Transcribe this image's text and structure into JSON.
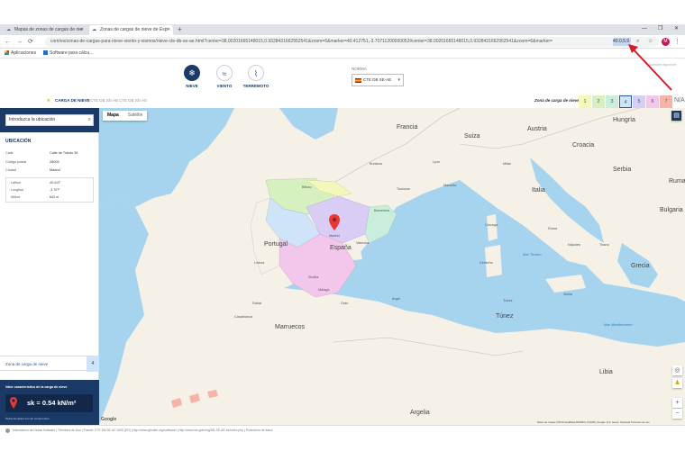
{
  "browser": {
    "tabs": [
      {
        "label": "Mapas de zonas de cargas de nie",
        "active": false
      },
      {
        "label": "Zonas de cargas de nieve de Esp",
        "active": true
      }
    ],
    "new_tab": "+",
    "window_controls": [
      "—",
      "❐",
      "✕"
    ],
    "url": "com/es/zonas-de-cargas-para-nieve-viento-y-sismos/nieve-cte-db-se-ae.html?center=38.00201665148015,0.9328431662952541&zoom=6&marker=40.412751,-3.70711200000052#center=38.00201665148015,0.9328431662952541&zoom=6&marker=",
    "url_highlight": "40.0,5.9",
    "avatar_letter": "M",
    "bookmarks": [
      "Aplicaciones",
      "Software para cálcu..."
    ]
  },
  "header": {
    "categories": [
      {
        "label": "NIEVE",
        "icon": "snowflake-icon",
        "glyph": "❄",
        "active": true
      },
      {
        "label": "VIENTO",
        "icon": "wind-icon",
        "glyph": "≈",
        "active": false
      },
      {
        "label": "TERREMOTO",
        "icon": "earthquake-icon",
        "glyph": "⌇",
        "active": false
      }
    ],
    "norma_label": "NORMA",
    "norma_value": "CTE DB SE-AE",
    "right_text": "Software disponible"
  },
  "breadcrumb": {
    "item1": "CARGA DE NIEVE",
    "item2": "CTE DB SE-AE",
    "item3": "CTE DB SE-AE"
  },
  "zones": {
    "label": "Zona de carga de nieve",
    "items": [
      {
        "n": "1",
        "color": "#f3f7b9"
      },
      {
        "n": "2",
        "color": "#d6f0c0"
      },
      {
        "n": "3",
        "color": "#c9eedc"
      },
      {
        "n": "4",
        "color": "#cfe4f8"
      },
      {
        "n": "5",
        "color": "#d9cdf5"
      },
      {
        "n": "6",
        "color": "#f3c6ec"
      },
      {
        "n": "7",
        "color": "#f6b3a8"
      }
    ],
    "selected": "4",
    "na": "N/A"
  },
  "sidebar": {
    "search_placeholder": "Introduzca la ubicación",
    "section_title": "UBICACIÓN",
    "rows": [
      {
        "k": "Calle",
        "v": "Calle de Toledo 39"
      },
      {
        "k": "Código postal",
        "v": "28005"
      },
      {
        "k": "Ciudad",
        "v": "Madrid"
      }
    ],
    "geo": [
      {
        "k": "Latitud",
        "v": "40.413°"
      },
      {
        "k": "Longitud",
        "v": "-3.707°"
      },
      {
        "k": "Altitud",
        "v": "643 m"
      }
    ],
    "zona_label": "Zona de carga de nieve",
    "zona_value": "4",
    "sk_title": "Valor característico de la carga de nieve",
    "sk_value": "sk = 0.54 kN/m²",
    "sk_note": "Todos los datos son sin compromiso."
  },
  "map": {
    "type_buttons": [
      "Mapa",
      "Satélite"
    ],
    "labels": [
      {
        "text": "Francia",
        "cls": "country"
      },
      {
        "text": "España",
        "cls": "country"
      },
      {
        "text": "Portugal",
        "cls": "country"
      },
      {
        "text": "Italia",
        "cls": "country"
      },
      {
        "text": "Hungría",
        "cls": "country"
      },
      {
        "text": "Rumania",
        "cls": "country"
      },
      {
        "text": "Grecia",
        "cls": "country"
      },
      {
        "text": "Túnez",
        "cls": "country"
      },
      {
        "text": "Argelia",
        "cls": "country"
      },
      {
        "text": "Libia",
        "cls": "country"
      },
      {
        "text": "Marruecos",
        "cls": "country"
      },
      {
        "text": "Serbia",
        "cls": "country"
      },
      {
        "text": "Bulgaria",
        "cls": "country"
      },
      {
        "text": "Croacia",
        "cls": "country"
      },
      {
        "text": "Austria",
        "cls": "country"
      },
      {
        "text": "Suiza",
        "cls": "country"
      },
      {
        "text": "Madrid",
        "cls": "city"
      },
      {
        "text": "Roma",
        "cls": "city"
      },
      {
        "text": "Nápoles",
        "cls": "city"
      },
      {
        "text": "Sicilia",
        "cls": "city"
      },
      {
        "text": "Cerdeña",
        "cls": "city"
      },
      {
        "text": "Córcega",
        "cls": "city"
      },
      {
        "text": "Túnez",
        "cls": "city"
      },
      {
        "text": "Argel",
        "cls": "city"
      },
      {
        "text": "Orán",
        "cls": "city"
      },
      {
        "text": "Barcelona",
        "cls": "city"
      },
      {
        "text": "Lisboa",
        "cls": "city"
      },
      {
        "text": "Valencia",
        "cls": "city"
      },
      {
        "text": "Sevilla",
        "cls": "city"
      },
      {
        "text": "Málaga",
        "cls": "city"
      },
      {
        "text": "Bilbao",
        "cls": "city"
      },
      {
        "text": "Marsella",
        "cls": "city"
      },
      {
        "text": "Lyon",
        "cls": "city"
      },
      {
        "text": "Milán",
        "cls": "city"
      },
      {
        "text": "Burdeos",
        "cls": "city"
      },
      {
        "text": "Toulouse",
        "cls": "city"
      },
      {
        "text": "Tirana",
        "cls": "city"
      },
      {
        "text": "Casablanca",
        "cls": "city"
      },
      {
        "text": "Rabat",
        "cls": "city"
      },
      {
        "text": "Mar Tirreno",
        "cls": "sea"
      },
      {
        "text": "Mar Mediterráneo",
        "cls": "sea"
      }
    ],
    "attribution": "Datos de mapas ©2019 GeoBasis-DE/BKG (©2009), Google, Inst. Geogr. Nacional",
    "terms": "Términos de uso",
    "google_logo": "Google"
  },
  "footer": {
    "text": "Información de Dlubal Software  |  Términos de Uso  |  Fuente: CTE DB SE-AE 2009 (ES)  |  http://www.geodim.org/software/  |  http://www.ine.gob/mig/DB-SE-AE-es/index.php  |  Protección de datos"
  },
  "colors": {
    "navy": "#1b3a68",
    "accent_blue": "#2a5b9a",
    "sea": "#a6d3ee",
    "land": "#f5f1e6",
    "arrow_red": "#d7192a"
  }
}
